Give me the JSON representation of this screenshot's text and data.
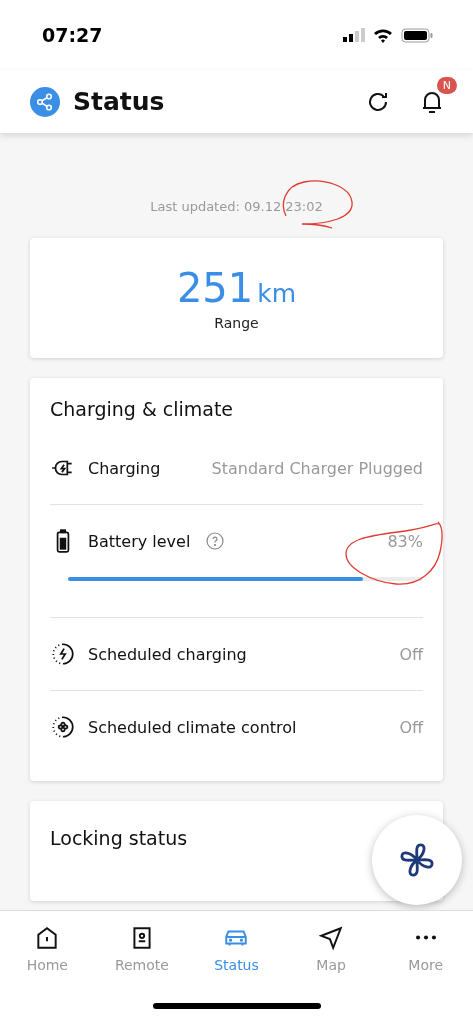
{
  "status_bar": {
    "time": "07:27"
  },
  "header": {
    "title": "Status",
    "notification_badge": "N"
  },
  "last_updated": "Last updated: 09.12 23:02",
  "range": {
    "value": "251",
    "unit": "km",
    "label": "Range"
  },
  "charging_climate": {
    "title": "Charging & climate",
    "rows": [
      {
        "kind": "value",
        "label": "Charging",
        "value": "Standard Charger Plugged"
      },
      {
        "kind": "battery",
        "label": "Battery level",
        "value": "83%",
        "level": 0.83
      },
      {
        "kind": "value",
        "label": "Scheduled charging",
        "value": "Off"
      },
      {
        "kind": "value",
        "label": "Scheduled climate control",
        "value": "Off"
      }
    ]
  },
  "locking": {
    "title": "Locking status"
  },
  "nav": [
    {
      "label": "Home",
      "selected": false
    },
    {
      "label": "Remote",
      "selected": false
    },
    {
      "label": "Status",
      "selected": true
    },
    {
      "label": "Map",
      "selected": false
    },
    {
      "label": "More",
      "selected": false
    }
  ]
}
